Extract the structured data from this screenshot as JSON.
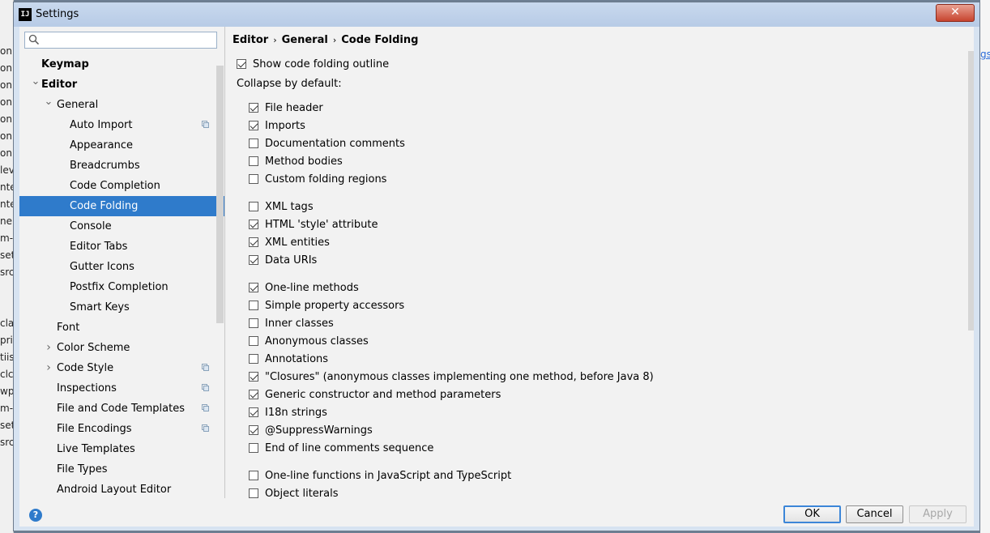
{
  "window": {
    "title": "Settings",
    "app_icon": "IJ",
    "close_glyph": "✕"
  },
  "background_left": [
    "on",
    "on",
    "on",
    "on",
    "on",
    "on",
    "on",
    "lev",
    "nte",
    "nte",
    "ner",
    "m-",
    "set",
    "src",
    "",
    "",
    "cla",
    "pri",
    "tiis",
    "clc",
    "wp",
    "m-",
    "set",
    "src",
    "",
    "",
    ""
  ],
  "background_right": {
    "link": "gs"
  },
  "search": {
    "placeholder": "",
    "value": ""
  },
  "tree": [
    {
      "label": "Keymap",
      "bold": true,
      "level": 0,
      "arrow": ""
    },
    {
      "label": "Editor",
      "bold": true,
      "level": 0,
      "arrow": "down"
    },
    {
      "label": "General",
      "level": 1,
      "arrow": "down"
    },
    {
      "label": "Auto Import",
      "level": 2,
      "copy": true
    },
    {
      "label": "Appearance",
      "level": 2
    },
    {
      "label": "Breadcrumbs",
      "level": 2
    },
    {
      "label": "Code Completion",
      "level": 2
    },
    {
      "label": "Code Folding",
      "level": 2,
      "selected": true
    },
    {
      "label": "Console",
      "level": 2
    },
    {
      "label": "Editor Tabs",
      "level": 2
    },
    {
      "label": "Gutter Icons",
      "level": 2
    },
    {
      "label": "Postfix Completion",
      "level": 2
    },
    {
      "label": "Smart Keys",
      "level": 2
    },
    {
      "label": "Font",
      "level": 1
    },
    {
      "label": "Color Scheme",
      "level": 1,
      "arrow": "right"
    },
    {
      "label": "Code Style",
      "level": 1,
      "arrow": "right",
      "copy": true
    },
    {
      "label": "Inspections",
      "level": 1,
      "copy": true
    },
    {
      "label": "File and Code Templates",
      "level": 1,
      "copy": true
    },
    {
      "label": "File Encodings",
      "level": 1,
      "copy": true
    },
    {
      "label": "Live Templates",
      "level": 1
    },
    {
      "label": "File Types",
      "level": 1
    },
    {
      "label": "Android Layout Editor",
      "level": 1
    }
  ],
  "breadcrumb": [
    "Editor",
    "General",
    "Code Folding"
  ],
  "breadcrumb_sep": "›",
  "show_outline": {
    "label": "Show code folding outline",
    "checked": true
  },
  "collapse_label": "Collapse by default:",
  "options": [
    {
      "label": "File header",
      "checked": true,
      "group": 0
    },
    {
      "label": "Imports",
      "checked": true,
      "group": 0
    },
    {
      "label": "Documentation comments",
      "checked": false,
      "group": 0
    },
    {
      "label": "Method bodies",
      "checked": false,
      "group": 0
    },
    {
      "label": "Custom folding regions",
      "checked": false,
      "group": 0
    },
    {
      "label": "XML tags",
      "checked": false,
      "group": 1
    },
    {
      "label": "HTML 'style' attribute",
      "checked": true,
      "group": 1
    },
    {
      "label": "XML entities",
      "checked": true,
      "group": 1
    },
    {
      "label": "Data URIs",
      "checked": true,
      "group": 1
    },
    {
      "label": "One-line methods",
      "checked": true,
      "group": 2
    },
    {
      "label": "Simple property accessors",
      "checked": false,
      "group": 2
    },
    {
      "label": "Inner classes",
      "checked": false,
      "group": 2
    },
    {
      "label": "Anonymous classes",
      "checked": false,
      "group": 2
    },
    {
      "label": "Annotations",
      "checked": false,
      "group": 2
    },
    {
      "label": "\"Closures\" (anonymous classes implementing one method, before Java 8)",
      "checked": true,
      "group": 2
    },
    {
      "label": "Generic constructor and method parameters",
      "checked": true,
      "group": 2
    },
    {
      "label": "I18n strings",
      "checked": true,
      "group": 2
    },
    {
      "label": "@SuppressWarnings",
      "checked": true,
      "group": 2
    },
    {
      "label": "End of line comments sequence",
      "checked": false,
      "group": 2
    },
    {
      "label": "One-line functions in JavaScript and TypeScript",
      "checked": false,
      "group": 3
    },
    {
      "label": "Object literals",
      "checked": false,
      "group": 3
    }
  ],
  "buttons": {
    "ok": "OK",
    "cancel": "Cancel",
    "apply": "Apply"
  },
  "help_glyph": "?"
}
